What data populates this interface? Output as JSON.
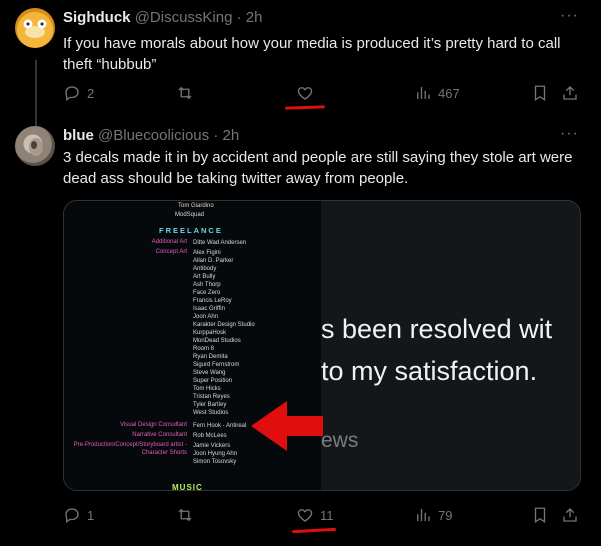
{
  "tweet1": {
    "name": "Sighduck",
    "handle": "@DiscussKing",
    "dot": "·",
    "time": "2h",
    "text": "If you have morals about how your media is produced it’s pretty hard to call theft “hubbub”",
    "replies": "2",
    "likes": "",
    "views": "467",
    "more": "···"
  },
  "tweet2": {
    "name": "blue",
    "handle": "@Bluecoolicious",
    "dot": "·",
    "time": "2h",
    "text": "3 decals made it in by accident and people are still saying they stole art were dead ass should be taking twitter away from people.",
    "replies": "1",
    "likes": "11",
    "views": "79",
    "more": "···"
  },
  "media": {
    "credits_top": [
      "Tom Giardino",
      "ModSquad"
    ],
    "freelance_heading": "FREELANCE",
    "roles": [
      {
        "role": "Additional Art",
        "names": [
          "Ditte Wad Andersen"
        ]
      },
      {
        "role": "Concept Art",
        "names": [
          "Alex Figini",
          "Allan D. Parker",
          "Antibody",
          "Art Bully",
          "Ash Thorp",
          "Face Zero",
          "Francis LeRoy",
          "Isaac Griffin",
          "Joon Ahn",
          "Karakter Design Studio",
          "KurppaHosk",
          "MonDead Studios",
          "Room 8",
          "Ryan Demita",
          "Sigurd Fernstrom",
          "Steve Wang",
          "Super Position",
          "Tom Hicks",
          "Tristan Reyes",
          "Tyler Bartley",
          "West Studios"
        ]
      },
      {
        "role": "Visual Design Consultant",
        "names": [
          "Fern Hook - Antireal"
        ]
      },
      {
        "role": "Narrative Consultant",
        "names": [
          "Rob McLees"
        ]
      },
      {
        "role": "Pre-Production/Concept/Storyboard artist -",
        "names": [
          "Jamie Vickers"
        ]
      },
      {
        "role": "Character Shorts",
        "names": [
          "Joon Hyung Ahn",
          "Simon Tosovsky"
        ]
      }
    ],
    "music_heading": "MUSIC",
    "quote_line1": "s been resolved wit",
    "quote_line2": "to my satisfaction.",
    "quote_line3": "ews"
  },
  "colors": {
    "background": "#000000",
    "text": "#e7e9ea",
    "muted": "#71767b",
    "annotation_red": "#e10e0e",
    "credit_role_pink": "#e45dbb",
    "credit_heading_cyan": "#6fd3e8",
    "credit_music_green": "#b6f05a"
  },
  "icons": [
    "reply-icon",
    "retweet-icon",
    "heart-icon",
    "views-icon",
    "bookmark-icon",
    "share-icon",
    "more-icon",
    "red-arrow-annotation"
  ]
}
